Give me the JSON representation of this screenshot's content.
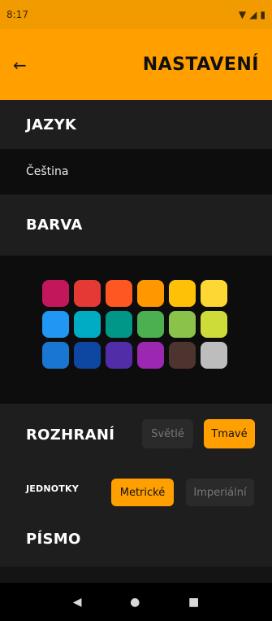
{
  "status": {
    "time": "8:17"
  },
  "appbar": {
    "title": "NASTAVENÍ",
    "back_icon": "arrow-left-icon"
  },
  "sections": {
    "language": {
      "header": "JAZYK",
      "value": "Čeština"
    },
    "color": {
      "header": "BARVA",
      "swatches": [
        "#c2185b",
        "#e53935",
        "#ff5722",
        "#ff9800",
        "#ffc107",
        "#fdd835",
        "#2196f3",
        "#00acc1",
        "#009688",
        "#4caf50",
        "#8bc34a",
        "#cddc39",
        "#1976d2",
        "#0d47a1",
        "#512da8",
        "#9c27b0",
        "#4e342e",
        "#bdbdbd"
      ]
    },
    "ui": {
      "header": "ROZHRANÍ",
      "light_label": "Světlé",
      "dark_label": "Tmavé",
      "selected": "dark"
    },
    "units": {
      "header": "JEDNOTKY",
      "metric_label": "Metrické",
      "imperial_label": "Imperiální",
      "selected": "metric"
    },
    "font": {
      "header": "PÍSMO"
    }
  },
  "navbar": {
    "back": "◀",
    "home": "●",
    "recents": "■"
  }
}
